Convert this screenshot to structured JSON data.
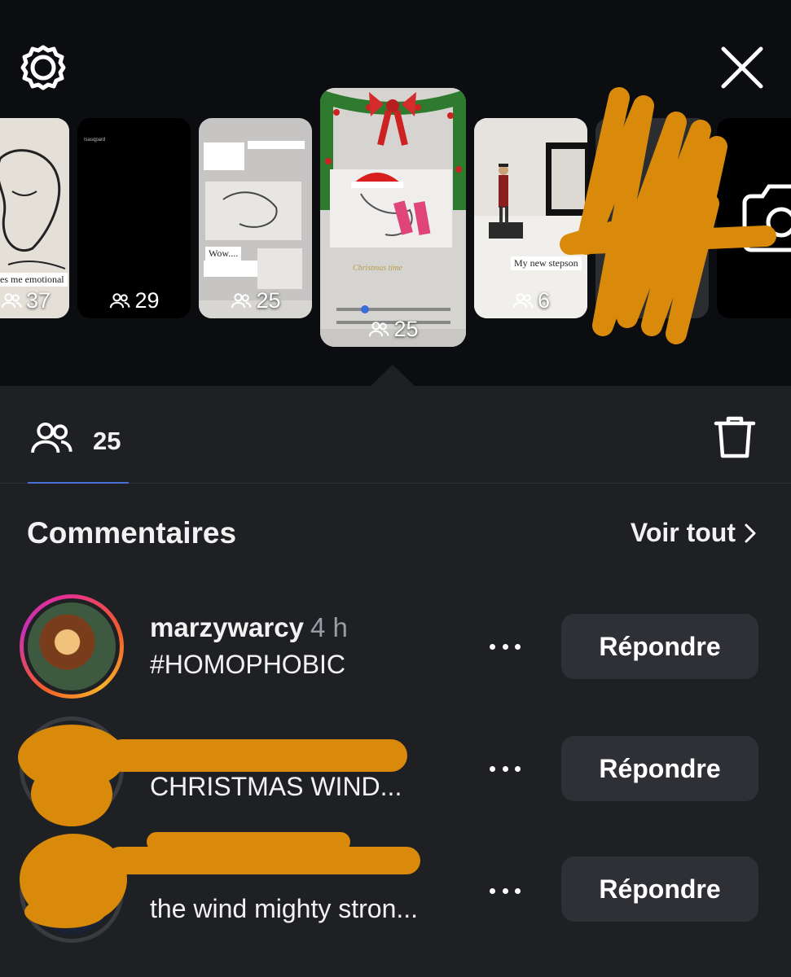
{
  "header": {
    "settings_icon": "gear-icon",
    "close_icon": "close-icon"
  },
  "stories": [
    {
      "viewers": "37",
      "caption": "kes me emotional"
    },
    {
      "viewers": "29",
      "caption": "Isasqpard"
    },
    {
      "viewers": "25",
      "caption": "Wow...."
    },
    {
      "viewers": "25",
      "caption": "Christmas time"
    },
    {
      "viewers": "6",
      "caption": "My new stepson"
    },
    {
      "viewers": "",
      "caption": ""
    }
  ],
  "viewers_tab": {
    "count": "25",
    "icon": "people-icon"
  },
  "comments": {
    "title": "Commentaires",
    "see_all": "Voir tout",
    "items": [
      {
        "user": "marzywarcy",
        "time": "4 h",
        "text": "#HOMOPHOBIC",
        "reply": "Répondre"
      },
      {
        "user": "",
        "time": "",
        "text": "CHRISTMAS WIND...",
        "reply": "Répondre"
      },
      {
        "user": "",
        "time": "",
        "text": "the wind mighty stron...",
        "reply": "Répondre"
      }
    ]
  },
  "colors": {
    "background": "#1f2024",
    "top_strip": "#0c0d10",
    "button": "#2e3036",
    "accent_underline": "#4a6fd8",
    "scribble": "#d98a0a"
  }
}
